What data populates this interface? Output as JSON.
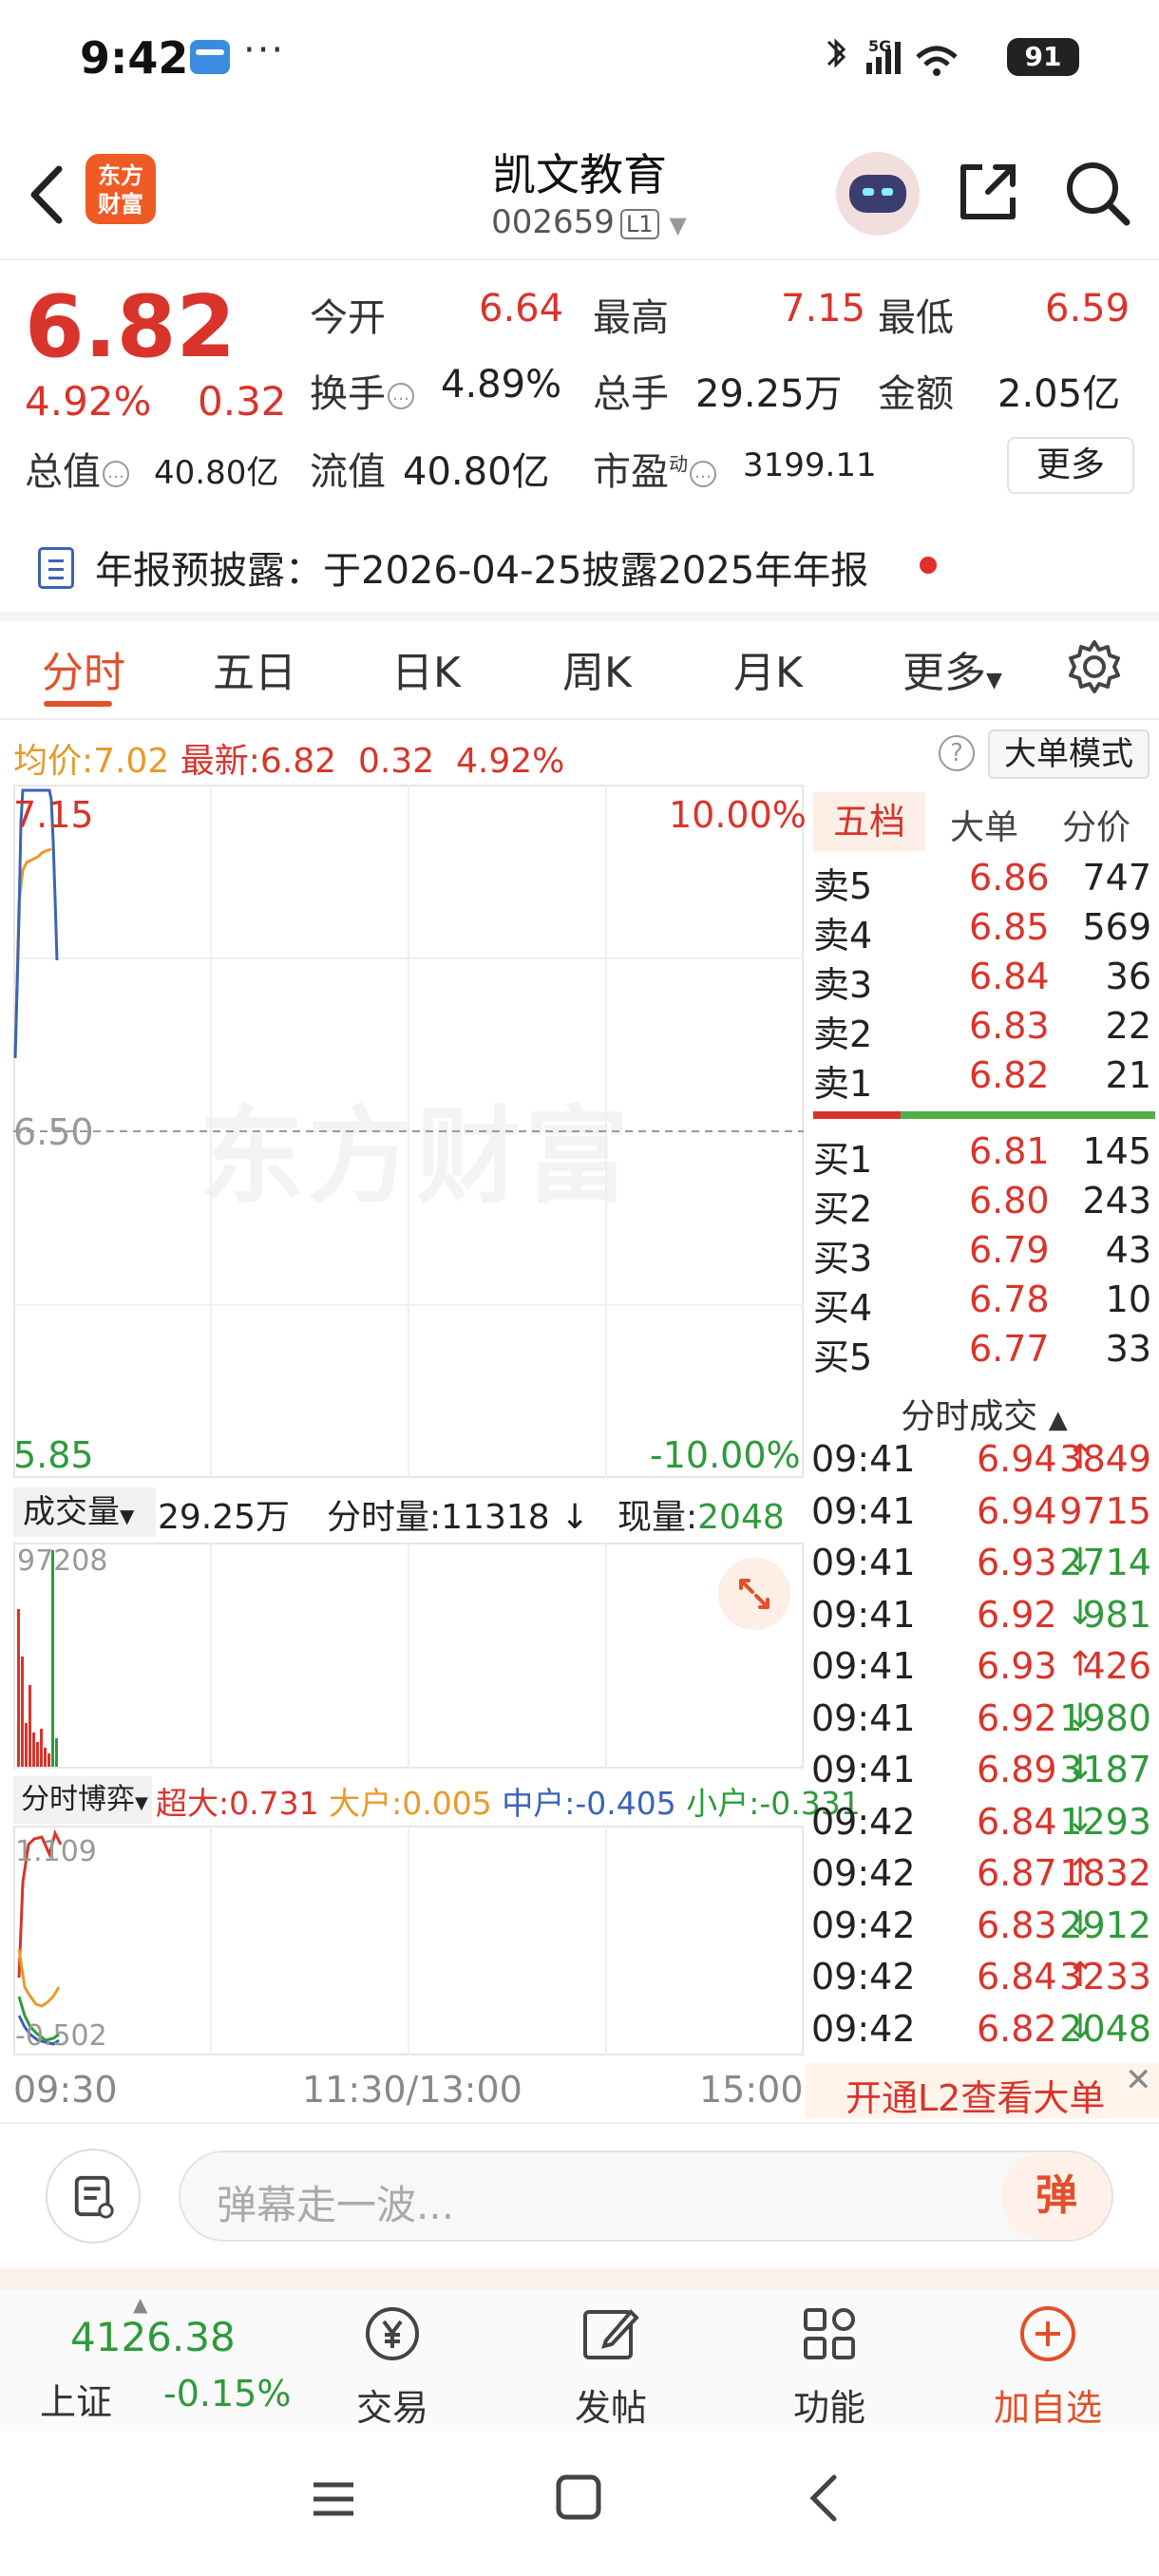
{
  "status_bar": {
    "time": "9:42",
    "dots": "···",
    "network": "5G",
    "battery": "91"
  },
  "header": {
    "stock_name": "凯文教育",
    "stock_code": "002659",
    "level_tag": "L1",
    "logo_text_line1": "东方",
    "logo_text_line2": "财富"
  },
  "quote": {
    "price": "6.82",
    "pct_change": "4.92%",
    "abs_change": "0.32",
    "fields": [
      {
        "label": "今开",
        "value": "6.64",
        "color": "red"
      },
      {
        "label": "最高",
        "value": "7.15",
        "color": "red"
      },
      {
        "label": "最低",
        "value": "6.59",
        "color": "red"
      },
      {
        "label": "换手",
        "value": "4.89%",
        "color": "black"
      },
      {
        "label": "总手",
        "value": "29.25万",
        "color": "black"
      },
      {
        "label": "金额",
        "value": "2.05亿",
        "color": "black"
      },
      {
        "label": "总值",
        "value": "40.80亿",
        "color": "black"
      },
      {
        "label": "流值",
        "value": "40.80亿",
        "color": "black"
      },
      {
        "label": "市盈",
        "value": "3199.11",
        "color": "black",
        "sup": "动"
      }
    ],
    "more_label": "更多"
  },
  "notice": {
    "text": "年报预披露：于2026-04-25披露2025年年报"
  },
  "chart_tabs": [
    "分时",
    "五日",
    "日K",
    "周K",
    "月K",
    "更多"
  ],
  "avg_row": {
    "avg_label": "均价:",
    "avg_value": "7.02",
    "latest_label": "最新:",
    "latest_value": "6.82",
    "change": "0.32",
    "pct": "4.92%",
    "mode_button": "大单模式",
    "help": "?"
  },
  "chart": {
    "high_label": "7.15",
    "up_pct": "10.00%",
    "mid_label": "6.50",
    "low_label": "5.85",
    "down_pct": "-10.00%",
    "watermark": "东方财富"
  },
  "volume": {
    "selector": "成交量",
    "total": "29.25万",
    "tick_label": "分时量:",
    "tick_value": "11318",
    "now_label": "现量:",
    "now_value": "2048",
    "max_label": "97208"
  },
  "flow": {
    "selector": "分时博弈",
    "items": [
      {
        "label": "超大:",
        "value": "0.731",
        "color": "#d9342b"
      },
      {
        "label": "大户:",
        "value": "0.005",
        "color": "#e89a2a"
      },
      {
        "label": "中户:",
        "value": "-0.405",
        "color": "#3a63b8"
      },
      {
        "label": "小户:",
        "value": "-0.331",
        "color": "#2e9a3a"
      }
    ],
    "max_label": "1.109",
    "min_label": "-0.502"
  },
  "time_axis": [
    "09:30",
    "11:30/13:00",
    "15:00"
  ],
  "order_book": {
    "tabs": [
      "五档",
      "大单",
      "分价"
    ],
    "asks": [
      {
        "label": "卖5",
        "price": "6.86",
        "vol": "747"
      },
      {
        "label": "卖4",
        "price": "6.85",
        "vol": "569"
      },
      {
        "label": "卖3",
        "price": "6.84",
        "vol": "36"
      },
      {
        "label": "卖2",
        "price": "6.83",
        "vol": "22"
      },
      {
        "label": "卖1",
        "price": "6.82",
        "vol": "21"
      }
    ],
    "bids": [
      {
        "label": "买1",
        "price": "6.81",
        "vol": "145"
      },
      {
        "label": "买2",
        "price": "6.80",
        "vol": "243"
      },
      {
        "label": "买3",
        "price": "6.79",
        "vol": "43"
      },
      {
        "label": "买4",
        "price": "6.78",
        "vol": "10"
      },
      {
        "label": "买5",
        "price": "6.77",
        "vol": "33"
      }
    ]
  },
  "trades": {
    "title": "分时成交",
    "rows": [
      {
        "time": "09:41",
        "price": "6.94",
        "dir": "up",
        "vol": "3849"
      },
      {
        "time": "09:41",
        "price": "6.94",
        "dir": "",
        "vol": "9715"
      },
      {
        "time": "09:41",
        "price": "6.93",
        "dir": "down",
        "vol": "2714"
      },
      {
        "time": "09:41",
        "price": "6.92",
        "dir": "down",
        "vol": "981"
      },
      {
        "time": "09:41",
        "price": "6.93",
        "dir": "up",
        "vol": "426"
      },
      {
        "time": "09:41",
        "price": "6.92",
        "dir": "down",
        "vol": "1980"
      },
      {
        "time": "09:41",
        "price": "6.89",
        "dir": "down",
        "vol": "3187"
      },
      {
        "time": "09:42",
        "price": "6.84",
        "dir": "down",
        "vol": "1293"
      },
      {
        "time": "09:42",
        "price": "6.87",
        "dir": "up",
        "vol": "1832"
      },
      {
        "time": "09:42",
        "price": "6.83",
        "dir": "down",
        "vol": "2912"
      },
      {
        "time": "09:42",
        "price": "6.84",
        "dir": "up",
        "vol": "3233"
      },
      {
        "time": "09:42",
        "price": "6.82",
        "dir": "down",
        "vol": "2048"
      }
    ],
    "l2_banner": "开通L2查看大单"
  },
  "comment": {
    "placeholder": "弹幕走一波...",
    "danmu_label": "弹"
  },
  "bottom_nav": {
    "index_value": "4126.38",
    "index_name": "上证",
    "index_change": "-0.15%",
    "items": [
      {
        "label": "交易",
        "icon": "trade-yen-icon"
      },
      {
        "label": "发帖",
        "icon": "edit-post-icon"
      },
      {
        "label": "功能",
        "icon": "grid-functions-icon"
      },
      {
        "label": "加自选",
        "icon": "add-watchlist-icon"
      }
    ]
  },
  "colors": {
    "up": "#d9342b",
    "down": "#2e9a3a",
    "avg": "#e89a2a",
    "accent": "#e2502a"
  }
}
